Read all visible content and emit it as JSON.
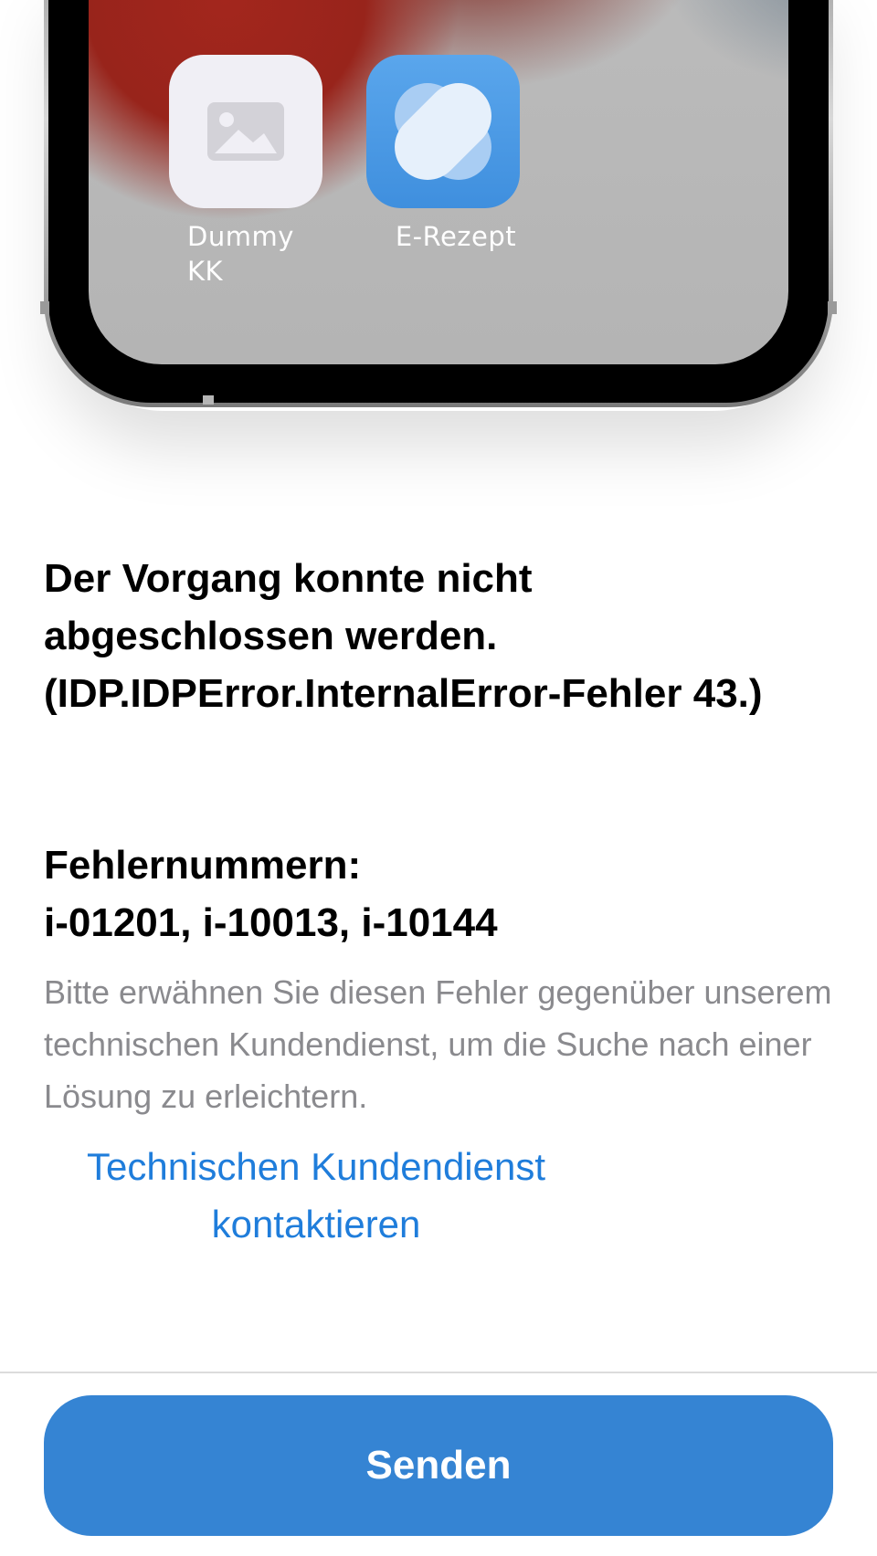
{
  "illustration": {
    "apps": [
      {
        "label": "Dummy KK",
        "icon": "image-placeholder-icon"
      },
      {
        "label": "E-Rezept",
        "icon": "e-rezept-logo-icon"
      }
    ]
  },
  "error": {
    "message": "Der Vorgang konnte nicht abgeschlossen werden. (IDP.IDPError.InternalError-Fehler 43.)",
    "codes_label": "Fehlernummern:",
    "codes": "i-01201, i-10013, i-10144",
    "hint": "Bitte erwähnen Sie diesen Fehler gegenüber unserem technischen Kundendienst, um die Suche nach einer Lösung zu erleichtern.",
    "support_link": "Technischen Kundendienst kontaktieren"
  },
  "footer": {
    "send_label": "Senden"
  },
  "colors": {
    "link": "#1f7ddb",
    "button": "#3584d3",
    "hint": "#8a8a8e",
    "app_blue": "#4a98e4"
  }
}
